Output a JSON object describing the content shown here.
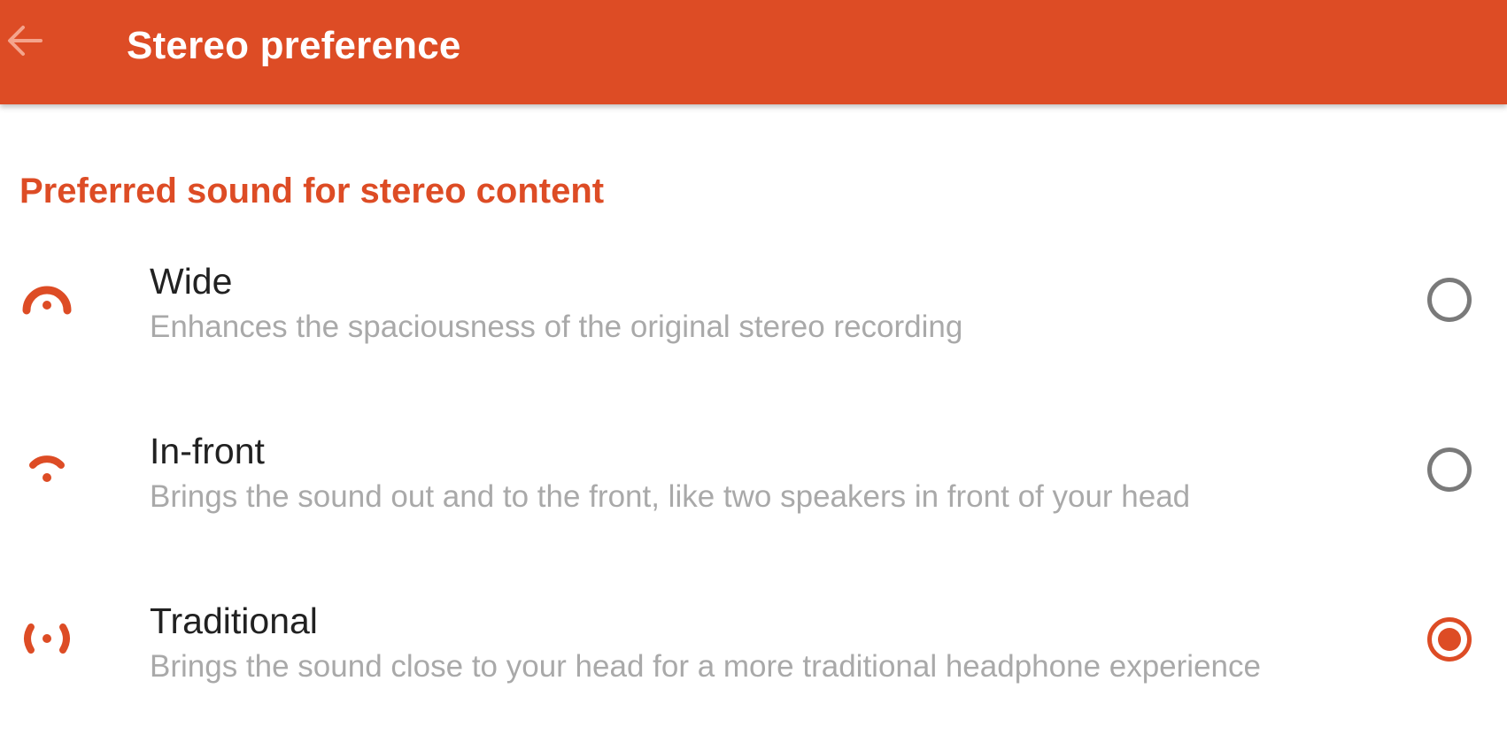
{
  "appbar": {
    "title": "Stereo preference",
    "background_color": "#dd4c25",
    "back_icon": "arrow-left-icon"
  },
  "section": {
    "header": "Preferred sound for stereo content"
  },
  "accent_color": "#dd4c25",
  "options": [
    {
      "title": "Wide",
      "description": "Enhances the spaciousness of the original stereo recording",
      "icon": "wide-sound-icon",
      "selected": false
    },
    {
      "title": "In-front",
      "description": "Brings the sound out and to the front, like two speakers in front of your head",
      "icon": "in-front-sound-icon",
      "selected": false
    },
    {
      "title": "Traditional",
      "description": "Brings the sound close to your head for a more traditional headphone experience",
      "icon": "traditional-sound-icon",
      "selected": true
    }
  ]
}
